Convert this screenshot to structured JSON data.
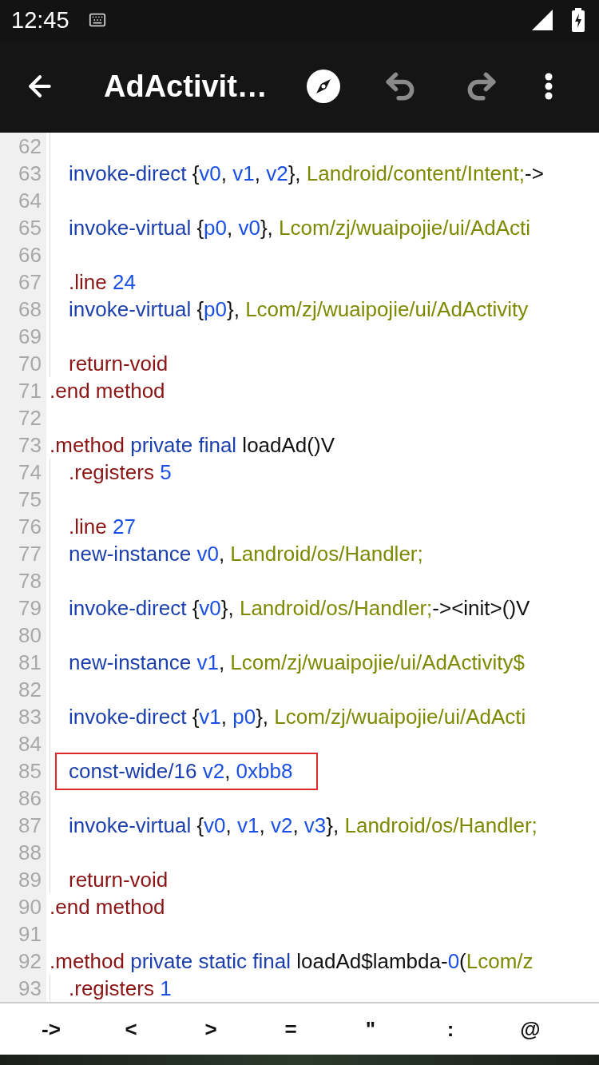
{
  "status_bar": {
    "time": "12:45"
  },
  "toolbar": {
    "title": "AdActivit…",
    "undo_disabled": true,
    "redo_disabled": true
  },
  "code_lines": [
    {
      "number": "62",
      "kind": "body"
    },
    {
      "number": "63",
      "kind": "body",
      "tokens": [
        {
          "kind": "op",
          "text": "invoke-direct "
        },
        {
          "kind": "text",
          "text": "{"
        },
        {
          "kind": "reg",
          "text": "v0"
        },
        {
          "kind": "text",
          "text": ", "
        },
        {
          "kind": "reg",
          "text": "v1"
        },
        {
          "kind": "text",
          "text": ", "
        },
        {
          "kind": "reg",
          "text": "v2"
        },
        {
          "kind": "text",
          "text": "}, "
        },
        {
          "kind": "type",
          "text": "Landroid/content/Intent;"
        },
        {
          "kind": "text",
          "text": "->"
        }
      ]
    },
    {
      "number": "64",
      "kind": "body"
    },
    {
      "number": "65",
      "kind": "body",
      "tokens": [
        {
          "kind": "op",
          "text": "invoke-virtual "
        },
        {
          "kind": "text",
          "text": "{"
        },
        {
          "kind": "reg",
          "text": "p0"
        },
        {
          "kind": "text",
          "text": ", "
        },
        {
          "kind": "reg",
          "text": "v0"
        },
        {
          "kind": "text",
          "text": "}, "
        },
        {
          "kind": "type",
          "text": "Lcom/zj/wuaipojie/ui/AdActi"
        }
      ]
    },
    {
      "number": "66",
      "kind": "body"
    },
    {
      "number": "67",
      "kind": "body",
      "tokens": [
        {
          "kind": "dir",
          "text": ".line "
        },
        {
          "kind": "reg",
          "text": "24"
        }
      ]
    },
    {
      "number": "68",
      "kind": "body",
      "tokens": [
        {
          "kind": "op",
          "text": "invoke-virtual "
        },
        {
          "kind": "text",
          "text": "{"
        },
        {
          "kind": "reg",
          "text": "p0"
        },
        {
          "kind": "text",
          "text": "}, "
        },
        {
          "kind": "type",
          "text": "Lcom/zj/wuaipojie/ui/AdActivity"
        }
      ]
    },
    {
      "number": "69",
      "kind": "body"
    },
    {
      "number": "70",
      "kind": "body",
      "tokens": [
        {
          "kind": "dir",
          "text": "return-void"
        }
      ]
    },
    {
      "number": "71",
      "kind": "top",
      "tokens": [
        {
          "kind": "dir",
          "text": ".end method"
        }
      ]
    },
    {
      "number": "72",
      "kind": "top"
    },
    {
      "number": "73",
      "kind": "top",
      "tokens": [
        {
          "kind": "dir",
          "text": ".method "
        },
        {
          "kind": "op",
          "text": "private final "
        },
        {
          "kind": "text",
          "text": "loadAd()V"
        }
      ]
    },
    {
      "number": "74",
      "kind": "body",
      "tokens": [
        {
          "kind": "dir",
          "text": ".registers "
        },
        {
          "kind": "reg",
          "text": "5"
        }
      ]
    },
    {
      "number": "75",
      "kind": "body"
    },
    {
      "number": "76",
      "kind": "body",
      "tokens": [
        {
          "kind": "dir",
          "text": ".line "
        },
        {
          "kind": "reg",
          "text": "27"
        }
      ]
    },
    {
      "number": "77",
      "kind": "body",
      "tokens": [
        {
          "kind": "op",
          "text": "new-instance "
        },
        {
          "kind": "reg",
          "text": "v0"
        },
        {
          "kind": "text",
          "text": ", "
        },
        {
          "kind": "type",
          "text": "Landroid/os/Handler;"
        }
      ]
    },
    {
      "number": "78",
      "kind": "body"
    },
    {
      "number": "79",
      "kind": "body",
      "tokens": [
        {
          "kind": "op",
          "text": "invoke-direct "
        },
        {
          "kind": "text",
          "text": "{"
        },
        {
          "kind": "reg",
          "text": "v0"
        },
        {
          "kind": "text",
          "text": "}, "
        },
        {
          "kind": "type",
          "text": "Landroid/os/Handler;"
        },
        {
          "kind": "text",
          "text": "-><init>()V"
        }
      ]
    },
    {
      "number": "80",
      "kind": "body"
    },
    {
      "number": "81",
      "kind": "body",
      "tokens": [
        {
          "kind": "op",
          "text": "new-instance "
        },
        {
          "kind": "reg",
          "text": "v1"
        },
        {
          "kind": "text",
          "text": ", "
        },
        {
          "kind": "type",
          "text": "Lcom/zj/wuaipojie/ui/AdActivity$"
        }
      ]
    },
    {
      "number": "82",
      "kind": "body"
    },
    {
      "number": "83",
      "kind": "body",
      "tokens": [
        {
          "kind": "op",
          "text": "invoke-direct "
        },
        {
          "kind": "text",
          "text": "{"
        },
        {
          "kind": "reg",
          "text": "v1"
        },
        {
          "kind": "text",
          "text": ", "
        },
        {
          "kind": "reg",
          "text": "p0"
        },
        {
          "kind": "text",
          "text": "}, "
        },
        {
          "kind": "type",
          "text": "Lcom/zj/wuaipojie/ui/AdActi"
        }
      ]
    },
    {
      "number": "84",
      "kind": "body"
    },
    {
      "number": "85",
      "kind": "body",
      "boxed": true,
      "tokens": [
        {
          "kind": "op",
          "text": "const-wide/16 "
        },
        {
          "kind": "reg",
          "text": "v2"
        },
        {
          "kind": "text",
          "text": ", "
        },
        {
          "kind": "reg",
          "text": "0xbb8"
        }
      ]
    },
    {
      "number": "86",
      "kind": "body"
    },
    {
      "number": "87",
      "kind": "body",
      "tokens": [
        {
          "kind": "op",
          "text": "invoke-virtual "
        },
        {
          "kind": "text",
          "text": "{"
        },
        {
          "kind": "reg",
          "text": "v0"
        },
        {
          "kind": "text",
          "text": ", "
        },
        {
          "kind": "reg",
          "text": "v1"
        },
        {
          "kind": "text",
          "text": ", "
        },
        {
          "kind": "reg",
          "text": "v2"
        },
        {
          "kind": "text",
          "text": ", "
        },
        {
          "kind": "reg",
          "text": "v3"
        },
        {
          "kind": "text",
          "text": "}, "
        },
        {
          "kind": "type",
          "text": "Landroid/os/Handler;"
        }
      ]
    },
    {
      "number": "88",
      "kind": "body"
    },
    {
      "number": "89",
      "kind": "body",
      "tokens": [
        {
          "kind": "dir",
          "text": "return-void"
        }
      ]
    },
    {
      "number": "90",
      "kind": "top",
      "tokens": [
        {
          "kind": "dir",
          "text": ".end method"
        }
      ]
    },
    {
      "number": "91",
      "kind": "top"
    },
    {
      "number": "92",
      "kind": "top",
      "tokens": [
        {
          "kind": "dir",
          "text": ".method "
        },
        {
          "kind": "op",
          "text": "private static final "
        },
        {
          "kind": "text",
          "text": "loadAd$lambda-"
        },
        {
          "kind": "reg",
          "text": "0"
        },
        {
          "kind": "text",
          "text": "("
        },
        {
          "kind": "type",
          "text": "Lcom/z"
        }
      ]
    },
    {
      "number": "93",
      "kind": "body",
      "tokens": [
        {
          "kind": "dir",
          "text": ".registers "
        },
        {
          "kind": "reg",
          "text": "1"
        }
      ]
    }
  ],
  "symbol_keys": [
    "->",
    "<",
    ">",
    "=",
    "\"",
    ":",
    "@"
  ]
}
